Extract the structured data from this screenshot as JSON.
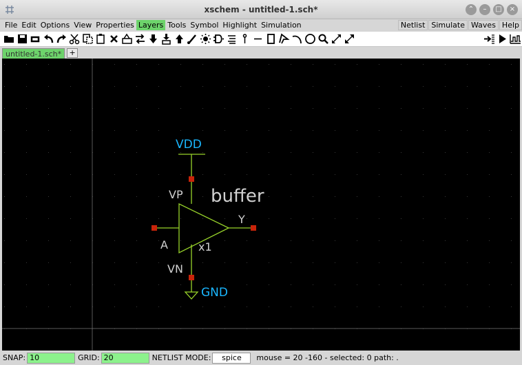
{
  "window": {
    "title": "xschem - untitled-1.sch*"
  },
  "menu": {
    "left": [
      "File",
      "Edit",
      "Options",
      "View",
      "Properties",
      "Layers",
      "Tools",
      "Symbol",
      "Highlight",
      "Simulation"
    ],
    "active": "Layers",
    "right": [
      "Netlist",
      "Simulate",
      "Waves",
      "Help"
    ]
  },
  "toolbar": {
    "icons": [
      "open-icon",
      "save-icon",
      "reload-icon",
      "undo-icon",
      "redo-icon",
      "cut-icon",
      "copy-icon",
      "paste-icon",
      "delete-icon",
      "insert-symbol-icon",
      "swap-icon",
      "push-down-icon",
      "pop-up-icon",
      "netlist-push-icon",
      "brush-icon",
      "highlight-icon",
      "symbol-gate-icon",
      "list-icon",
      "pin-icon",
      "line-icon",
      "rect-icon",
      "polygon-icon",
      "arc-icon",
      "circle-icon",
      "zoom-icon",
      "zoom-in-icon",
      "zoom-out-icon",
      "netlist-arrow-icon",
      "simulate-play-icon",
      "waves-icon"
    ]
  },
  "tabs": {
    "items": [
      "untitled-1.sch*"
    ],
    "add_label": "+"
  },
  "schematic": {
    "symbol_label": "buffer",
    "instance_name": "x1",
    "pins": {
      "vp": "VP",
      "vn": "VN",
      "a": "A",
      "y": "Y"
    },
    "power_label": "VDD",
    "ground_label": "GND",
    "colors": {
      "background": "#000000",
      "grid": "#3a3a3a",
      "wire": "#98d32a",
      "pin": "#c8240a",
      "net_label": "#1ab7ff",
      "text": "#d0d0d0"
    }
  },
  "status": {
    "snap_label": "SNAP:",
    "snap_value": "10",
    "grid_label": "GRID:",
    "grid_value": "20",
    "netlist_mode_label": "NETLIST MODE:",
    "netlist_mode_value": "spice",
    "info": "mouse = 20 -160 - selected: 0 path: ."
  }
}
